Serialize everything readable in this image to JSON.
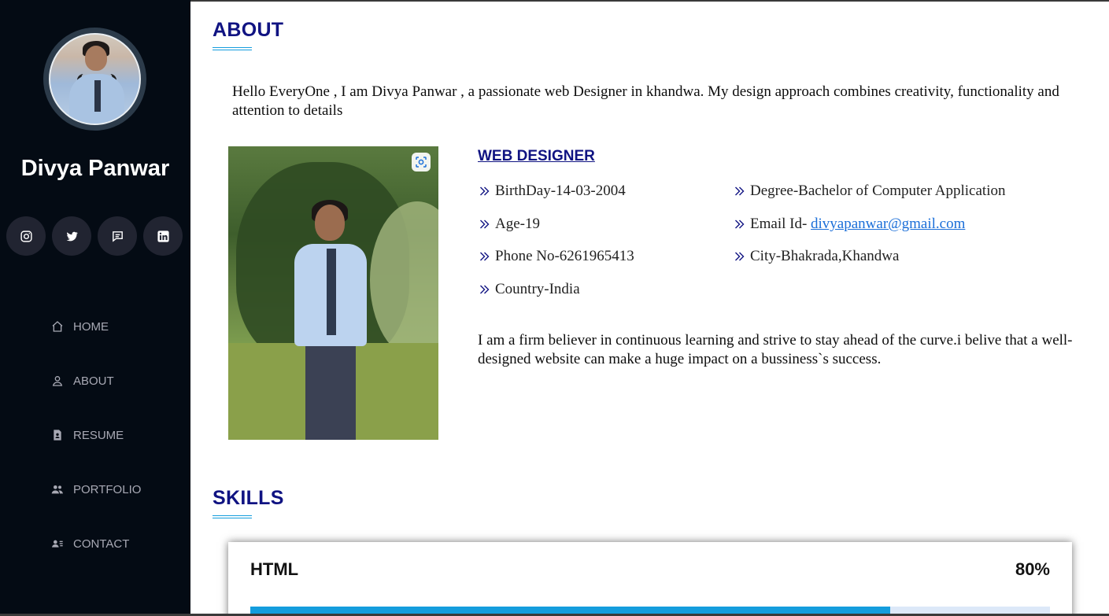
{
  "profile": {
    "name": "Divya Panwar"
  },
  "socials": [
    {
      "icon": "instagram-icon"
    },
    {
      "icon": "twitter-icon"
    },
    {
      "icon": "message-icon"
    },
    {
      "icon": "linkedin-icon"
    }
  ],
  "nav": [
    {
      "label": "HOME",
      "icon": "home-icon"
    },
    {
      "label": "ABOUT",
      "icon": "person-icon"
    },
    {
      "label": "RESUME",
      "icon": "file-icon"
    },
    {
      "label": "PORTFOLIO",
      "icon": "people-icon"
    },
    {
      "label": "CONTACT",
      "icon": "contact-card-icon"
    }
  ],
  "about": {
    "title": "ABOUT",
    "intro": "Hello EveryOne , I am Divya Panwar , a passionate web Designer in khandwa. My design approach combines creativity, functionality and attention to details",
    "role": "WEB DESIGNER",
    "facts_left": [
      "BirthDay-14-03-2004",
      "Age-19",
      "Phone No-6261965413",
      "Country-India"
    ],
    "facts_right": {
      "degree": "Degree-Bachelor of Computer Application",
      "email_label": "Email Id-",
      "email": "divyapanwar@gmail.com",
      "city": "City-Bhakrada,Khandwa"
    },
    "belief": "I am a firm believer in continuous learning and strive to stay ahead of the curve.i belive that a well-designed website can make a huge impact on a bussiness`s success."
  },
  "skills": {
    "title": "SKILLS",
    "items": [
      {
        "name": "HTML",
        "value_label": "80%",
        "value": 0.8
      }
    ]
  },
  "colors": {
    "sidebar_bg": "#040b14",
    "accent": "#149ddd",
    "heading": "#101382"
  }
}
